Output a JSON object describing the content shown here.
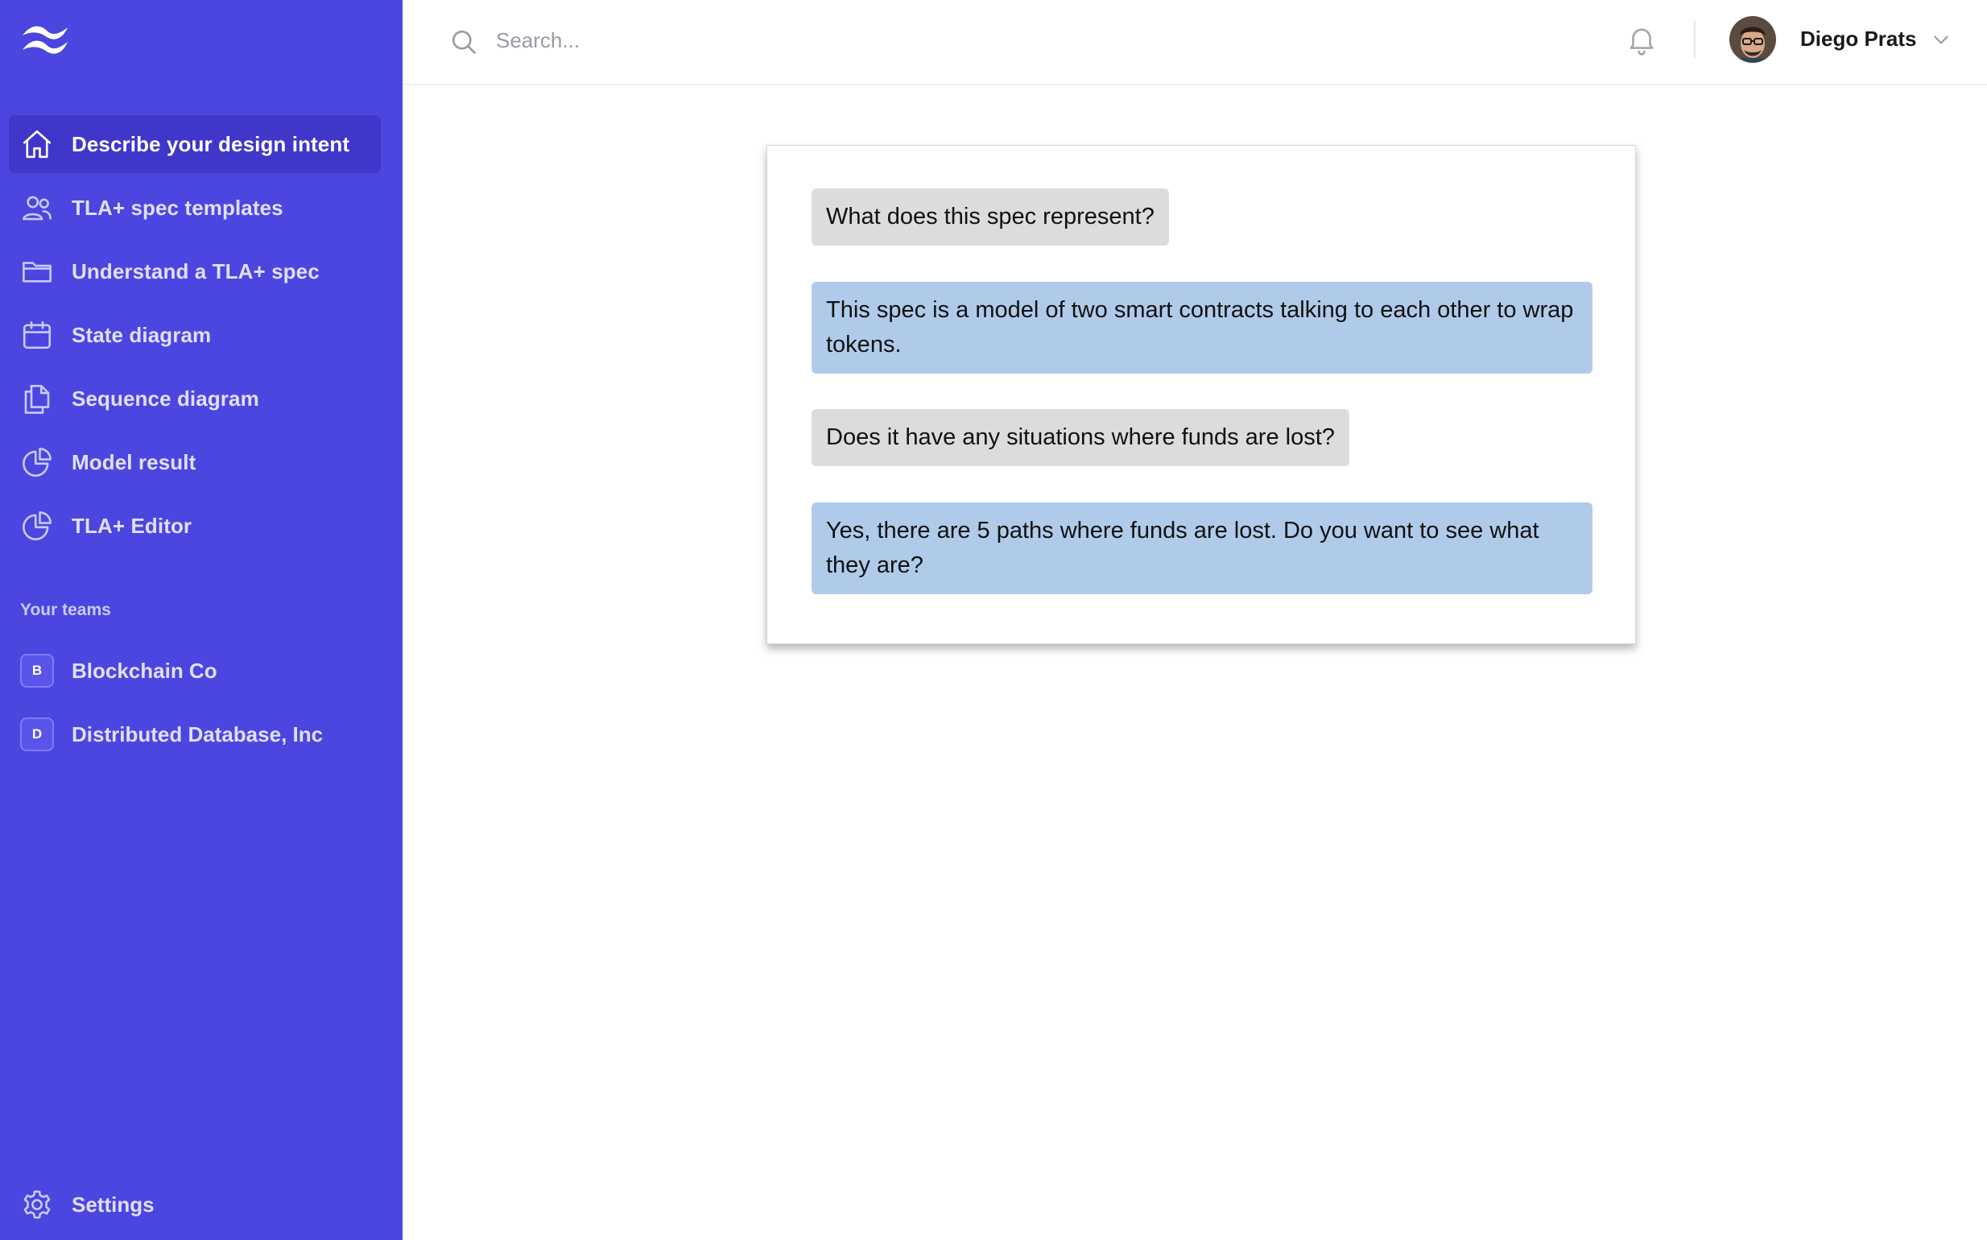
{
  "sidebar": {
    "logo": "tailwind-waves-logo",
    "nav": [
      {
        "label": "Describe your design intent",
        "icon": "home-icon",
        "active": true
      },
      {
        "label": "TLA+ spec templates",
        "icon": "users-icon",
        "active": false
      },
      {
        "label": "Understand a TLA+ spec",
        "icon": "folder-icon",
        "active": false
      },
      {
        "label": "State diagram",
        "icon": "calendar-icon",
        "active": false
      },
      {
        "label": "Sequence diagram",
        "icon": "documents-icon",
        "active": false
      },
      {
        "label": "Model result",
        "icon": "pie-chart-icon",
        "active": false
      },
      {
        "label": "TLA+ Editor",
        "icon": "pie-chart-icon",
        "active": false
      }
    ],
    "teams_title": "Your teams",
    "teams": [
      {
        "initial": "B",
        "name": "Blockchain Co"
      },
      {
        "initial": "D",
        "name": "Distributed Database, Inc"
      }
    ],
    "settings_label": "Settings",
    "colors": {
      "background": "#4b46df",
      "active": "#3f37c9"
    }
  },
  "topbar": {
    "search_placeholder": "Search...",
    "user_name": "Diego Prats"
  },
  "chat": {
    "messages": [
      {
        "role": "user",
        "text": "What does this spec represent?"
      },
      {
        "role": "assistant",
        "text": "This spec is a model of two smart contracts talking to each other to wrap tokens."
      },
      {
        "role": "user",
        "text": "Does it have any situations where funds are lost?"
      },
      {
        "role": "assistant",
        "text": "Yes, there are 5 paths where funds are lost. Do you want to see what they are?"
      }
    ],
    "colors": {
      "user_bubble": "#dcdcdc",
      "assistant_bubble": "#b0cbea"
    }
  }
}
